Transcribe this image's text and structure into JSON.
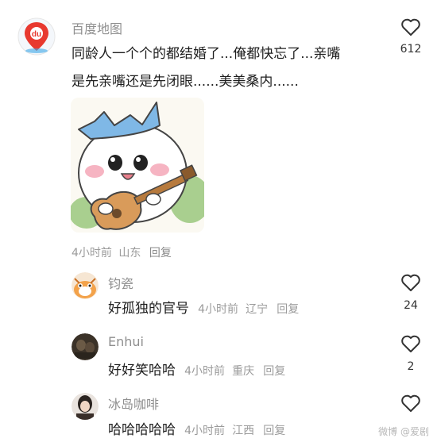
{
  "main_comment": {
    "author": "百度地图",
    "avatar_icon": "baidu-map-logo-icon",
    "avatar_logo_text": "du",
    "text_line1": "同龄人一个个的都结婚了...俺都快忘了...亲嘴",
    "text_line2": "是先亲嘴还是先闭眼......美美桑内......",
    "image_desc_icon": "cartoon-cat-guitar-sticker",
    "time": "4小时前",
    "location": "山东",
    "reply_label": "回复",
    "likes": "612"
  },
  "replies": [
    {
      "author": "钧瓷",
      "avatar_icon": "cartoon-avatar-icon",
      "text": "好孤独的官号",
      "time": "4小时前",
      "location": "辽宁",
      "reply_label": "回复",
      "likes": "24"
    },
    {
      "author": "Enhui",
      "avatar_icon": "photo-avatar-icon",
      "text": "好好笑哈哈",
      "time": "4小时前",
      "location": "重庆",
      "reply_label": "回复",
      "likes": "2"
    },
    {
      "author": "冰岛咖啡",
      "avatar_icon": "photo-avatar-icon",
      "text": "哈哈哈哈哈",
      "time": "4小时前",
      "location": "江西",
      "reply_label": "回复",
      "likes": ""
    }
  ],
  "watermark": "微博 @爱剧",
  "colors": {
    "baidu_red": "#e8392f",
    "baidu_blue": "#3aa6e8",
    "heart_stroke": "#333333"
  }
}
